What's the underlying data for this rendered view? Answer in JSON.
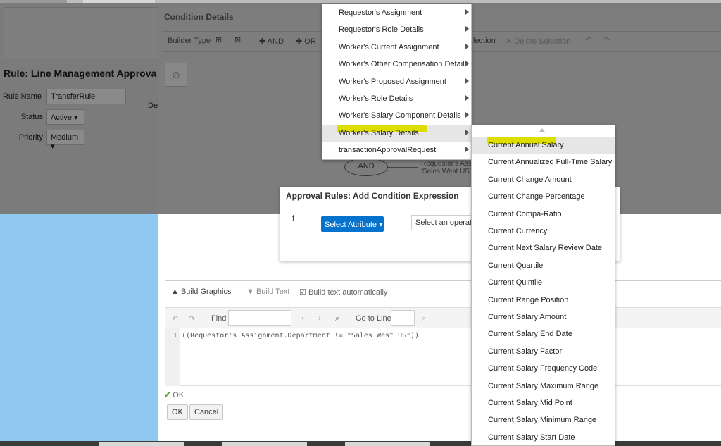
{
  "background": {
    "rule_title": "Rule: Line Management Approva",
    "rule_name_label": "Rule Name",
    "rule_name_value": "TransferRule",
    "status_label": "Status",
    "status_value": "Active",
    "priority_label": "Priority",
    "priority_value": "Medium",
    "description_label": "Des"
  },
  "panel": {
    "title": "Condition Details",
    "toolbar": {
      "builder_type": "Builder Type",
      "and_label": "AND",
      "or_label": "OR",
      "selection_label": "lection",
      "delete_selection": "Delete Selection"
    },
    "node_and": "AND",
    "condition_line1": "Requestor's Ass",
    "condition_line2": "'Sales West US'",
    "build_graphics": "Build Graphics",
    "build_text": "Build Text",
    "build_auto": "Build text automatically",
    "find_label": "Find",
    "goto_label": "Go to Line",
    "line_number": "1",
    "code": "((Requestor's Assignment.Department != \"Sales West US\"))",
    "status_ok": "OK",
    "ok_button": "OK",
    "cancel_button": "Cancel"
  },
  "dialog": {
    "title": "Approval Rules: Add Condition Expression",
    "if_label": "If",
    "select_attribute": "Select Attribute",
    "select_operator": "Select an operator"
  },
  "menu1": {
    "items": [
      "Requestor's Assignment",
      "Requestor's Role Details",
      "Worker's Current Assignment",
      "Worker's Other Compensation Details",
      "Worker's Proposed Assignment",
      "Worker's Role Details",
      "Worker's Salary Component Details",
      "Worker's Salary Details",
      "transactionApprovalRequest"
    ],
    "active_index": 7
  },
  "menu2": {
    "items": [
      "Current Annual Salary",
      "Current Annualized Full-Time Salary",
      "Current Change Amount",
      "Current Change Percentage",
      "Current Compa-Ratio",
      "Current Currency",
      "Current Next Salary Review Date",
      "Current Quartile",
      "Current Quintile",
      "Current Range Position",
      "Current Salary Amount",
      "Current Salary End Date",
      "Current Salary Factor",
      "Current Salary Frequency Code",
      "Current Salary Maximum Range",
      "Current Salary Mid Point",
      "Current Salary Minimum Range",
      "Current Salary Start Date"
    ],
    "active_index": 0
  },
  "colors": {
    "accent_blue": "#0572ce",
    "highlight_yellow": "#f5f500"
  }
}
